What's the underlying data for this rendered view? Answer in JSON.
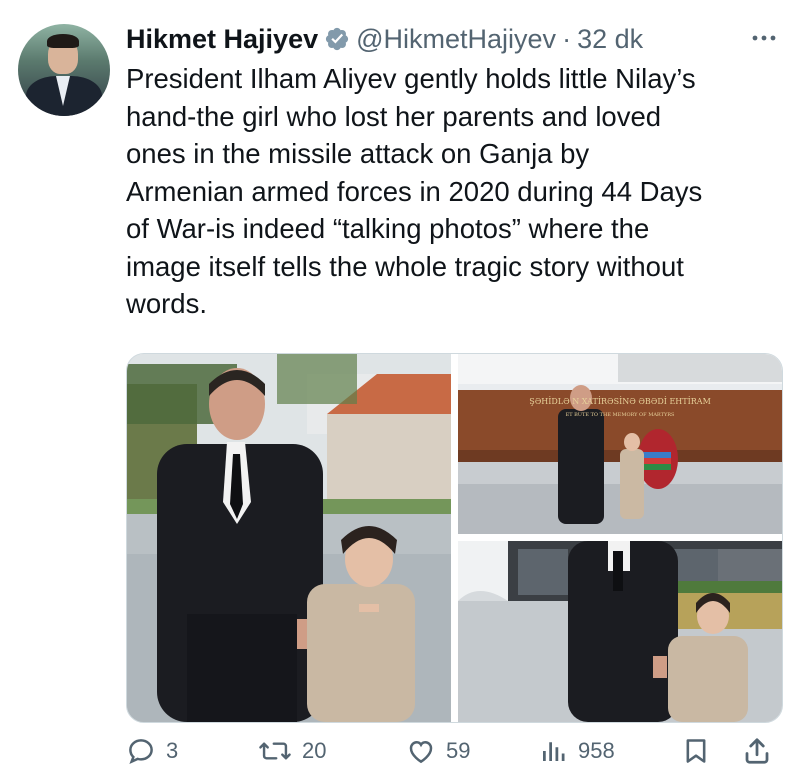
{
  "author": {
    "name": "Hikmet Hajiyev",
    "handle": "@HikmetHajiyev",
    "separator": "·",
    "time": "32 dk",
    "verified_color": "#829aab"
  },
  "tweet": {
    "text": "President Ilham Aliyev gently holds little Nilay’s\nhand-the girl who lost her parents and loved\nones in the missile attack on Ganja by\nArmenian armed forces in 2020 during 44 Days\nof War-is indeed “talking photos” where the\nimage itself tells the whole tragic story without\nwords."
  },
  "media": {
    "memorial_sign_line1": "ŞƏHİDLƏ  N XATİRƏSİNƏ ƏBƏDİ EHTİRAM",
    "memorial_sign_line2": "ET        BUTE TO THE MEMORY OF MARTYRS"
  },
  "actions": {
    "replies": "3",
    "retweets": "20",
    "likes": "59",
    "views": "958"
  },
  "icons": {
    "reply": "reply-icon",
    "retweet": "retweet-icon",
    "like": "heart-icon",
    "views": "views-icon",
    "bookmark": "bookmark-icon",
    "share": "share-icon",
    "more": "more-icon",
    "verified": "verified-badge-icon"
  },
  "colors": {
    "text": "#0f1419",
    "secondary": "#536471"
  }
}
